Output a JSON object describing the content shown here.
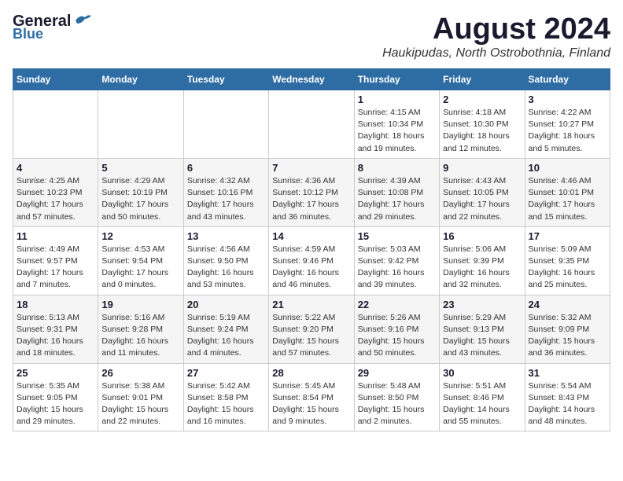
{
  "logo": {
    "line1": "General",
    "line2": "Blue"
  },
  "title": "August 2024",
  "location": "Haukipudas, North Ostrobothnia, Finland",
  "weekdays": [
    "Sunday",
    "Monday",
    "Tuesday",
    "Wednesday",
    "Thursday",
    "Friday",
    "Saturday"
  ],
  "weeks": [
    [
      {
        "day": "",
        "info": ""
      },
      {
        "day": "",
        "info": ""
      },
      {
        "day": "",
        "info": ""
      },
      {
        "day": "",
        "info": ""
      },
      {
        "day": "1",
        "info": "Sunrise: 4:15 AM\nSunset: 10:34 PM\nDaylight: 18 hours\nand 19 minutes."
      },
      {
        "day": "2",
        "info": "Sunrise: 4:18 AM\nSunset: 10:30 PM\nDaylight: 18 hours\nand 12 minutes."
      },
      {
        "day": "3",
        "info": "Sunrise: 4:22 AM\nSunset: 10:27 PM\nDaylight: 18 hours\nand 5 minutes."
      }
    ],
    [
      {
        "day": "4",
        "info": "Sunrise: 4:25 AM\nSunset: 10:23 PM\nDaylight: 17 hours\nand 57 minutes."
      },
      {
        "day": "5",
        "info": "Sunrise: 4:29 AM\nSunset: 10:19 PM\nDaylight: 17 hours\nand 50 minutes."
      },
      {
        "day": "6",
        "info": "Sunrise: 4:32 AM\nSunset: 10:16 PM\nDaylight: 17 hours\nand 43 minutes."
      },
      {
        "day": "7",
        "info": "Sunrise: 4:36 AM\nSunset: 10:12 PM\nDaylight: 17 hours\nand 36 minutes."
      },
      {
        "day": "8",
        "info": "Sunrise: 4:39 AM\nSunset: 10:08 PM\nDaylight: 17 hours\nand 29 minutes."
      },
      {
        "day": "9",
        "info": "Sunrise: 4:43 AM\nSunset: 10:05 PM\nDaylight: 17 hours\nand 22 minutes."
      },
      {
        "day": "10",
        "info": "Sunrise: 4:46 AM\nSunset: 10:01 PM\nDaylight: 17 hours\nand 15 minutes."
      }
    ],
    [
      {
        "day": "11",
        "info": "Sunrise: 4:49 AM\nSunset: 9:57 PM\nDaylight: 17 hours\nand 7 minutes."
      },
      {
        "day": "12",
        "info": "Sunrise: 4:53 AM\nSunset: 9:54 PM\nDaylight: 17 hours\nand 0 minutes."
      },
      {
        "day": "13",
        "info": "Sunrise: 4:56 AM\nSunset: 9:50 PM\nDaylight: 16 hours\nand 53 minutes."
      },
      {
        "day": "14",
        "info": "Sunrise: 4:59 AM\nSunset: 9:46 PM\nDaylight: 16 hours\nand 46 minutes."
      },
      {
        "day": "15",
        "info": "Sunrise: 5:03 AM\nSunset: 9:42 PM\nDaylight: 16 hours\nand 39 minutes."
      },
      {
        "day": "16",
        "info": "Sunrise: 5:06 AM\nSunset: 9:39 PM\nDaylight: 16 hours\nand 32 minutes."
      },
      {
        "day": "17",
        "info": "Sunrise: 5:09 AM\nSunset: 9:35 PM\nDaylight: 16 hours\nand 25 minutes."
      }
    ],
    [
      {
        "day": "18",
        "info": "Sunrise: 5:13 AM\nSunset: 9:31 PM\nDaylight: 16 hours\nand 18 minutes."
      },
      {
        "day": "19",
        "info": "Sunrise: 5:16 AM\nSunset: 9:28 PM\nDaylight: 16 hours\nand 11 minutes."
      },
      {
        "day": "20",
        "info": "Sunrise: 5:19 AM\nSunset: 9:24 PM\nDaylight: 16 hours\nand 4 minutes."
      },
      {
        "day": "21",
        "info": "Sunrise: 5:22 AM\nSunset: 9:20 PM\nDaylight: 15 hours\nand 57 minutes."
      },
      {
        "day": "22",
        "info": "Sunrise: 5:26 AM\nSunset: 9:16 PM\nDaylight: 15 hours\nand 50 minutes."
      },
      {
        "day": "23",
        "info": "Sunrise: 5:29 AM\nSunset: 9:13 PM\nDaylight: 15 hours\nand 43 minutes."
      },
      {
        "day": "24",
        "info": "Sunrise: 5:32 AM\nSunset: 9:09 PM\nDaylight: 15 hours\nand 36 minutes."
      }
    ],
    [
      {
        "day": "25",
        "info": "Sunrise: 5:35 AM\nSunset: 9:05 PM\nDaylight: 15 hours\nand 29 minutes."
      },
      {
        "day": "26",
        "info": "Sunrise: 5:38 AM\nSunset: 9:01 PM\nDaylight: 15 hours\nand 22 minutes."
      },
      {
        "day": "27",
        "info": "Sunrise: 5:42 AM\nSunset: 8:58 PM\nDaylight: 15 hours\nand 16 minutes."
      },
      {
        "day": "28",
        "info": "Sunrise: 5:45 AM\nSunset: 8:54 PM\nDaylight: 15 hours\nand 9 minutes."
      },
      {
        "day": "29",
        "info": "Sunrise: 5:48 AM\nSunset: 8:50 PM\nDaylight: 15 hours\nand 2 minutes."
      },
      {
        "day": "30",
        "info": "Sunrise: 5:51 AM\nSunset: 8:46 PM\nDaylight: 14 hours\nand 55 minutes."
      },
      {
        "day": "31",
        "info": "Sunrise: 5:54 AM\nSunset: 8:43 PM\nDaylight: 14 hours\nand 48 minutes."
      }
    ]
  ]
}
